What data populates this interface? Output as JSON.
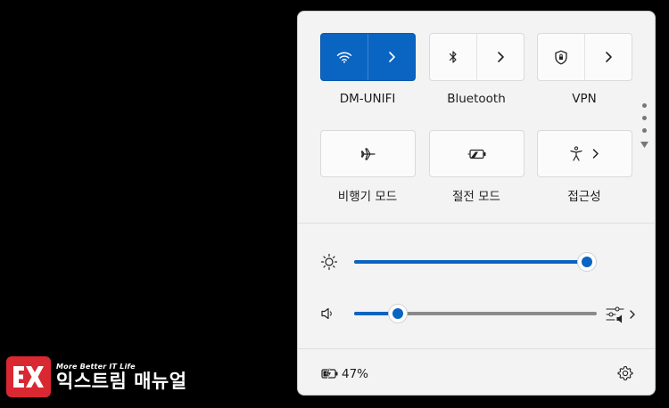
{
  "quick_settings": {
    "tiles_row1": [
      {
        "label": "DM-UNIFI",
        "icon": "wifi-icon",
        "state": "on"
      },
      {
        "label": "Bluetooth",
        "icon": "bluetooth-icon",
        "state": "off"
      },
      {
        "label": "VPN",
        "icon": "shield-icon",
        "state": "off"
      }
    ],
    "tiles_row2": [
      {
        "label": "비행기 모드",
        "icon": "airplane-icon"
      },
      {
        "label": "절전 모드",
        "icon": "battery-saver-icon"
      },
      {
        "label": "접근성",
        "icon": "accessibility-icon"
      }
    ],
    "pager": {
      "pages": 3,
      "current": 1
    },
    "brightness": {
      "icon": "brightness-icon",
      "value_percent": 100
    },
    "volume": {
      "icon": "speaker-icon",
      "value_percent": 18
    },
    "footer": {
      "battery_text": "47%",
      "battery_icon": "battery-charging-icon",
      "settings_icon": "gear-icon"
    }
  },
  "watermark": {
    "badge": "EX",
    "tagline": "More Better IT Life",
    "name": "익스트림 매뉴얼"
  },
  "colors": {
    "accent": "#0a64c2",
    "panel": "#f3f3f3",
    "logo_red": "#d92832"
  }
}
